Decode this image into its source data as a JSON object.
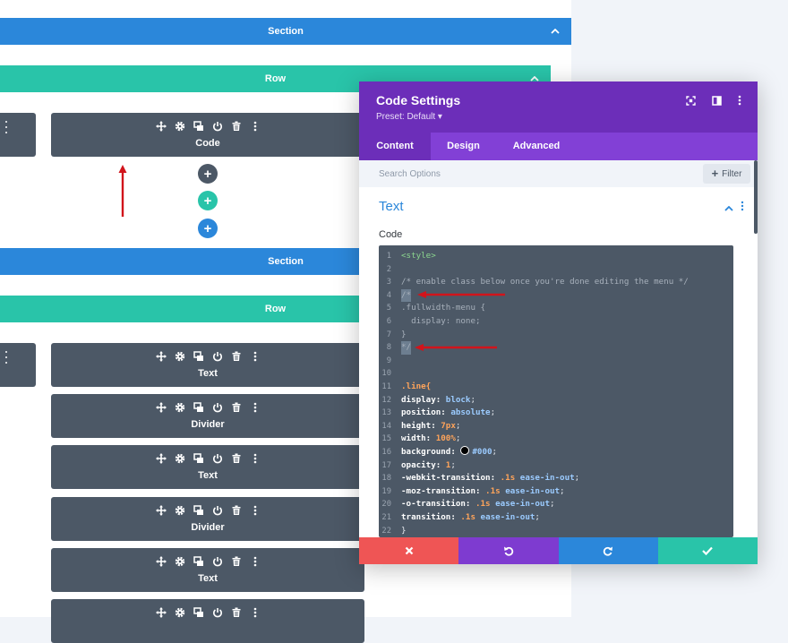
{
  "builder": {
    "sections": [
      {
        "label": "Section"
      },
      {
        "label": "Section"
      }
    ],
    "rows": [
      {
        "label": "Row"
      },
      {
        "label": "Row"
      }
    ],
    "modules": [
      {
        "label": "Code"
      },
      {
        "label": "Text"
      },
      {
        "label": "Divider"
      },
      {
        "label": "Text"
      },
      {
        "label": "Divider"
      },
      {
        "label": "Text"
      },
      {
        "label": ""
      }
    ],
    "add_buttons": [
      "+",
      "+",
      "+"
    ],
    "colors": {
      "section": "#2b87da",
      "row": "#29c4a9",
      "module": "#4c5866",
      "add_module": "#4c5866",
      "add_row": "#29c4a9",
      "add_section": "#2b87da"
    }
  },
  "panel": {
    "title": "Code Settings",
    "preset": "Preset: Default ▾",
    "tabs": [
      {
        "label": "Content",
        "active": true
      },
      {
        "label": "Design",
        "active": false
      },
      {
        "label": "Advanced",
        "active": false
      }
    ],
    "search_placeholder": "Search Options",
    "filter_label": "Filter",
    "toggle_title": "Text",
    "field_label": "Code",
    "code_lines": [
      {
        "n": "1",
        "text": "<style>"
      },
      {
        "n": "2",
        "text": ""
      },
      {
        "n": "3",
        "text": "/* enable class below once you're done editing the menu */"
      },
      {
        "n": "4",
        "text": "/*"
      },
      {
        "n": "5",
        "text": ".fullwidth-menu {"
      },
      {
        "n": "6",
        "text": "  display: none;"
      },
      {
        "n": "7",
        "text": "}"
      },
      {
        "n": "8",
        "text": "*/"
      },
      {
        "n": "9",
        "text": ""
      },
      {
        "n": "10",
        "text": ""
      },
      {
        "n": "11",
        "text": ".line{"
      },
      {
        "n": "12",
        "prop": "display: ",
        "val": "block",
        "end": ";"
      },
      {
        "n": "13",
        "prop": "position: ",
        "val": "absolute",
        "end": ";"
      },
      {
        "n": "14",
        "prop": "height: ",
        "num": "7px",
        "end": ";"
      },
      {
        "n": "15",
        "prop": "width: ",
        "num": "100%",
        "end": ";"
      },
      {
        "n": "16",
        "prop": "background: ",
        "val": "#000",
        "end": ";",
        "swatch": true
      },
      {
        "n": "17",
        "prop": "opacity: ",
        "num": "1",
        "end": ";"
      },
      {
        "n": "18",
        "prop": "-webkit-transition: ",
        "num": ".1s",
        "val": " ease-in-out",
        "end": ";"
      },
      {
        "n": "19",
        "prop": "-moz-transition: ",
        "num": ".1s",
        "val": " ease-in-out",
        "end": ";"
      },
      {
        "n": "20",
        "prop": "-o-transition: ",
        "num": ".1s",
        "val": " ease-in-out",
        "end": ";"
      },
      {
        "n": "21",
        "prop": "transition: ",
        "num": ".1s",
        "val": " ease-in-out",
        "end": ";"
      },
      {
        "n": "22",
        "text": "}"
      }
    ],
    "footer_colors": {
      "cancel": "#ef5555",
      "undo": "#7e3bd0",
      "redo": "#2b87da",
      "save": "#29c4a9"
    }
  }
}
